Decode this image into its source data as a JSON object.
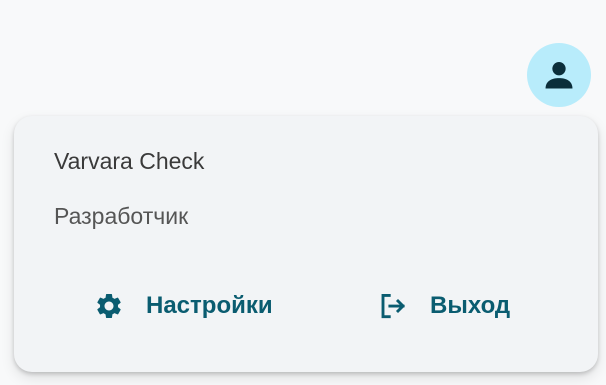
{
  "colors": {
    "accent": "#0a5c70",
    "avatar_bg": "#b8ecfb",
    "avatar_icon": "#0b2e3a"
  },
  "header": {
    "avatar_icon": "person-icon"
  },
  "user_menu": {
    "name": "Varvara Check",
    "role": "Разработчик",
    "settings": {
      "icon": "gear-icon",
      "label": "Настройки"
    },
    "logout": {
      "icon": "logout-icon",
      "label": "Выход"
    }
  }
}
